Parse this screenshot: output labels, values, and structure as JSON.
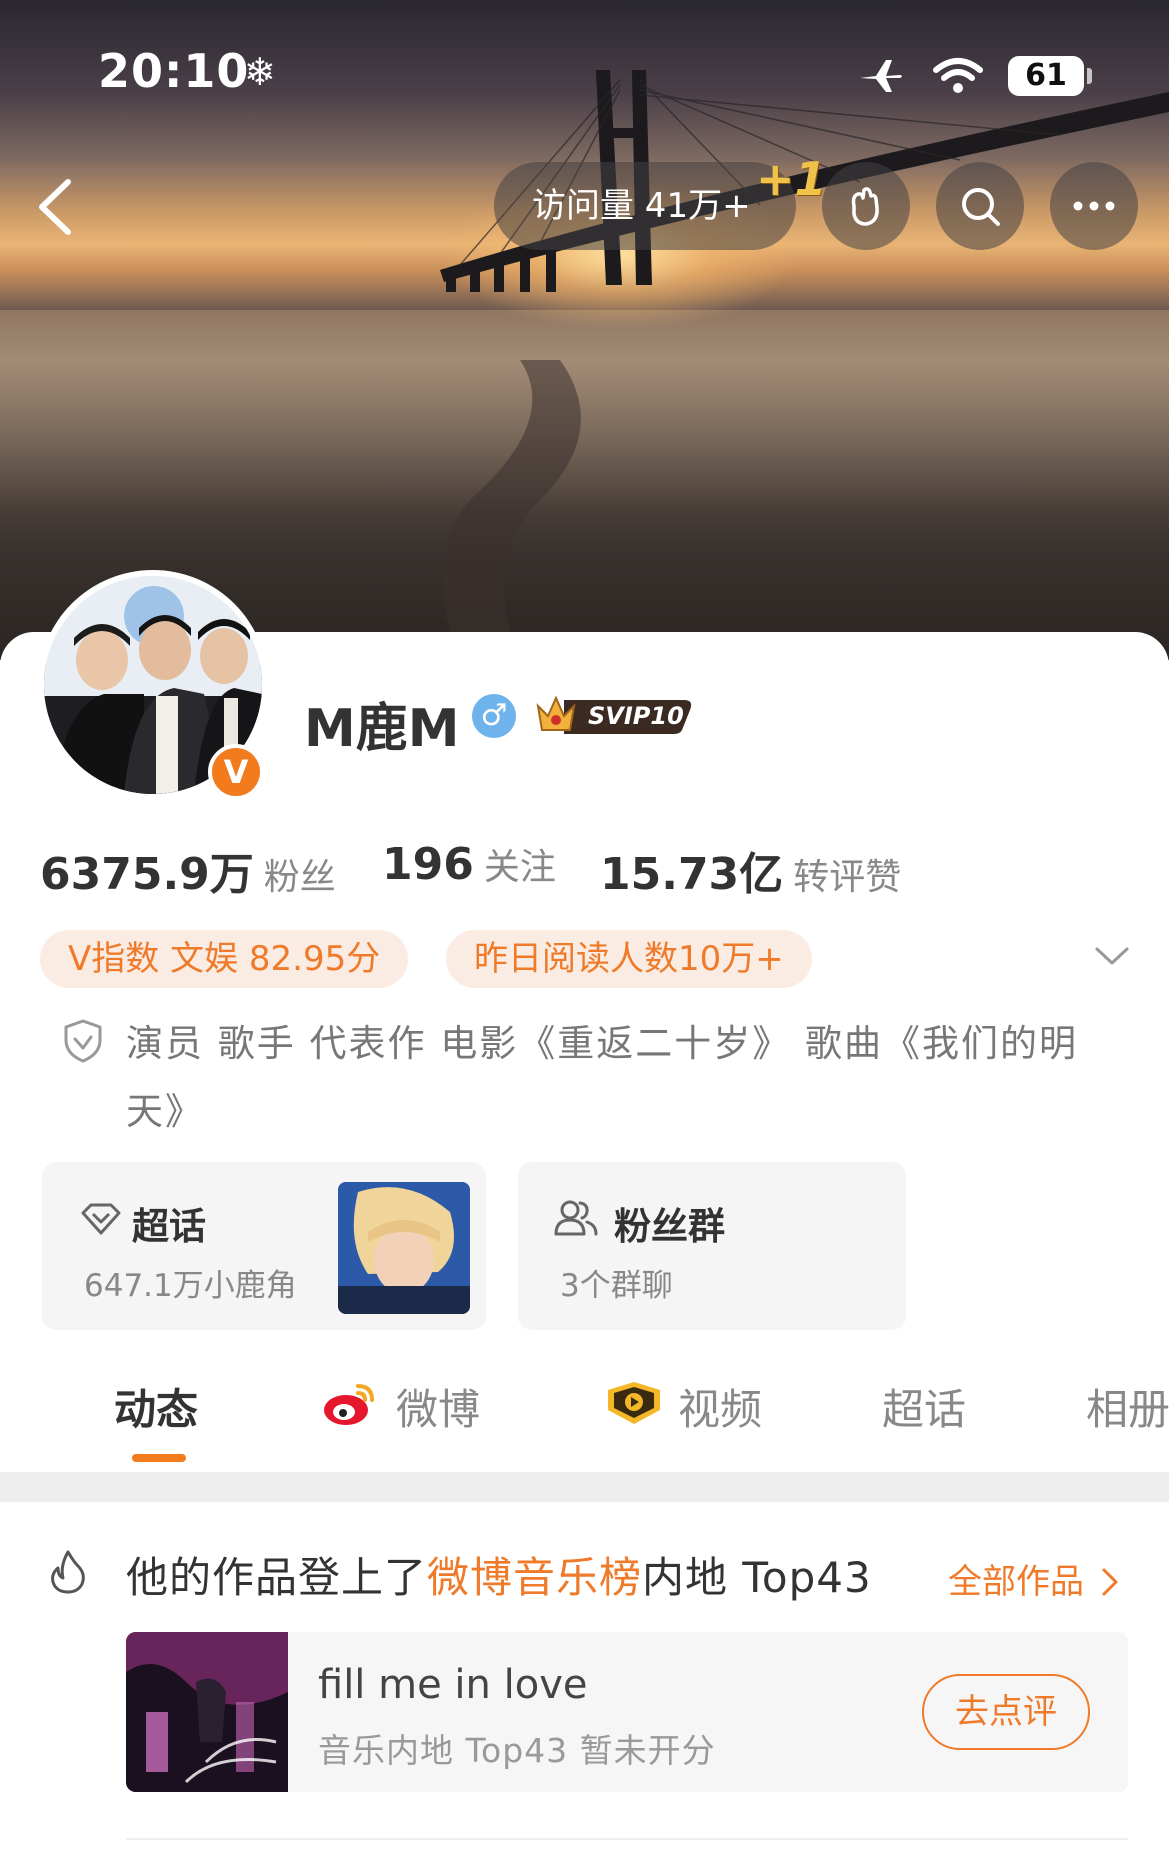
{
  "status_bar": {
    "time": "20:10",
    "snow_glyph": "❄",
    "battery": "61"
  },
  "header": {
    "visit_label": "访问量 41万+",
    "visit_plus": "+1"
  },
  "profile": {
    "name": "M鹿M",
    "gender_glyph": "♂",
    "svip_label": "SVIP10",
    "verified_glyph": "V",
    "stats": [
      {
        "value": "6375.9万",
        "label": "粉丝"
      },
      {
        "value": "196",
        "label": "关注"
      },
      {
        "value": "15.73亿",
        "label": "转评赞"
      }
    ],
    "chips": [
      "V指数 文娱 82.95分",
      "昨日阅读人数10万+"
    ],
    "bio": "演员 歌手 代表作 电影《重返二十岁》 歌曲《我们的明天》"
  },
  "boxes": {
    "topic": {
      "title": "超话",
      "sub": "647.1万小鹿角"
    },
    "fans": {
      "title": "粉丝群",
      "sub": "3个群聊"
    }
  },
  "tabs": [
    "动态",
    "微博",
    "视频",
    "超话",
    "相册"
  ],
  "notice": {
    "prefix": "他的作品登上了",
    "highlight": "微博音乐榜",
    "suffix": "内地 Top43",
    "all_works": "全部作品"
  },
  "song": {
    "title": "fill me in love",
    "sub": "音乐内地 Top43 暂未开分",
    "button": "去点评"
  },
  "colors": {
    "accent": "#ef7a2a",
    "chip_bg": "#fbece3",
    "gender": "#6fb3ec"
  }
}
